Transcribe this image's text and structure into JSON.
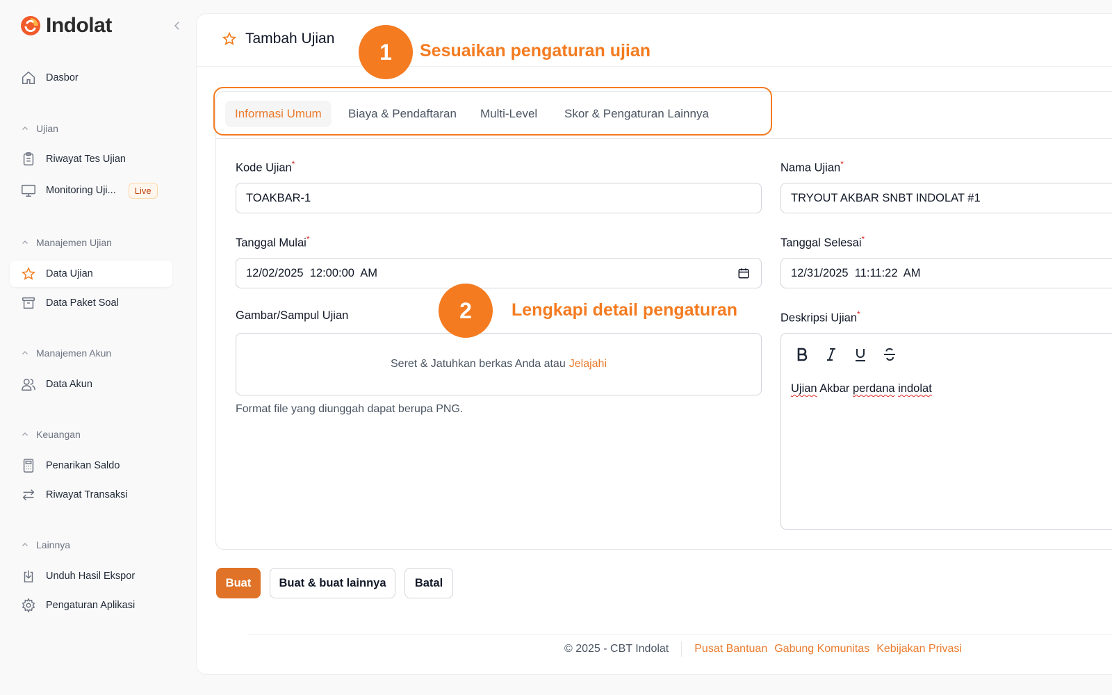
{
  "brand": {
    "name": "Indolat"
  },
  "sidebar": {
    "dashboard": "Dasbor",
    "groups": [
      {
        "title": "Ujian",
        "items": [
          {
            "label": "Riwayat Tes Ujian"
          },
          {
            "label": "Monitoring Uji...",
            "badge": "Live"
          }
        ]
      },
      {
        "title": "Manajemen Ujian",
        "items": [
          {
            "label": "Data Ujian"
          },
          {
            "label": "Data Paket Soal"
          }
        ]
      },
      {
        "title": "Manajemen Akun",
        "items": [
          {
            "label": "Data Akun"
          }
        ]
      },
      {
        "title": "Keuangan",
        "items": [
          {
            "label": "Penarikan Saldo"
          },
          {
            "label": "Riwayat Transaksi"
          }
        ]
      },
      {
        "title": "Lainnya",
        "items": [
          {
            "label": "Unduh Hasil Ekspor"
          },
          {
            "label": "Pengaturan Aplikasi"
          }
        ]
      }
    ]
  },
  "page": {
    "title": "Tambah Ujian"
  },
  "annotations": [
    {
      "number": "1",
      "text": "Sesuaikan pengaturan ujian"
    },
    {
      "number": "2",
      "text": "Lengkapi detail pengaturan"
    }
  ],
  "tabs": [
    {
      "label": "Informasi Umum",
      "active": true
    },
    {
      "label": "Biaya & Pendaftaran"
    },
    {
      "label": "Multi-Level"
    },
    {
      "label": "Skor & Pengaturan Lainnya"
    }
  ],
  "form": {
    "kode": {
      "label": "Kode Ujian",
      "value": "TOAKBAR-1"
    },
    "nama": {
      "label": "Nama Ujian",
      "value": "TRYOUT AKBAR SNBT INDOLAT #1"
    },
    "mulai": {
      "label": "Tanggal Mulai",
      "value": "12/02/2025  12:00:00  AM"
    },
    "selesai": {
      "label": "Tanggal Selesai",
      "value": "12/31/2025  11:11:22  AM"
    },
    "gambar": {
      "label": "Gambar/Sampul Ujian",
      "dropzone_text": "Seret & Jatuhkan berkas Anda atau",
      "dropzone_link": "Jelajahi",
      "helper": "Format file yang diunggah dapat berupa PNG."
    },
    "deskripsi": {
      "label": "Deskripsi Ujian",
      "words": [
        "Ujian",
        "Akbar",
        "perdana",
        "indolat"
      ]
    }
  },
  "buttons": {
    "create": "Buat",
    "create_another": "Buat & buat lainnya",
    "cancel": "Batal"
  },
  "footer": {
    "copyright": "© 2025 - CBT Indolat",
    "links": [
      "Pusat Bantuan",
      "Gabung Komunitas",
      "Kebijakan Privasi"
    ]
  },
  "colors": {
    "accent": "#f47b20",
    "primary_button": "#e07327"
  }
}
